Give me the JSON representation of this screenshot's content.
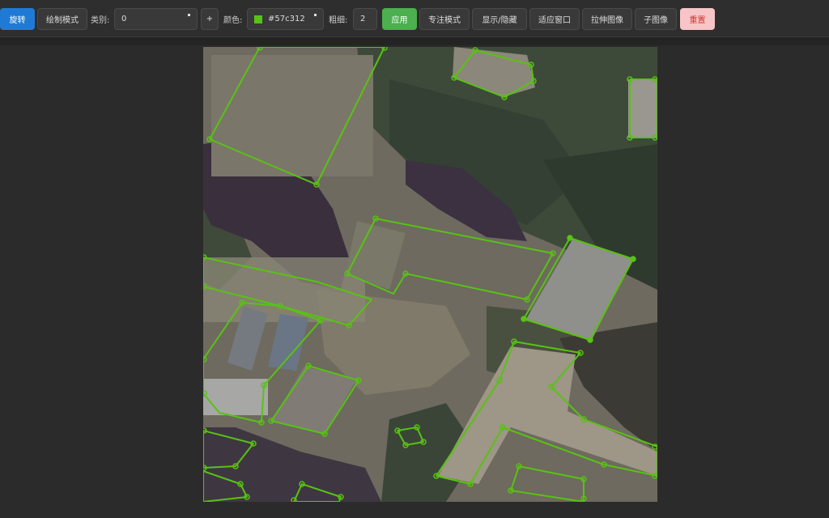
{
  "toolbar": {
    "rotate_label": "旋转",
    "draw_mode_label": "绘制模式",
    "category_label": "类别:",
    "category_value": "0",
    "add_label": "+",
    "color_label": "颜色:",
    "color_value": "#57c312",
    "color_swatch": "#57c312",
    "thickness_label": "粗细:",
    "thickness_value": "2",
    "apply_label": "应用",
    "focus_mode_label": "专注模式",
    "show_hide_label": "显示/隐藏",
    "fit_window_label": "适应窗口",
    "stretch_image_label": "拉伸图像",
    "sub_image_label": "子图像",
    "reset_label": "重置"
  },
  "annotation": {
    "stroke_color": "#57c312"
  }
}
